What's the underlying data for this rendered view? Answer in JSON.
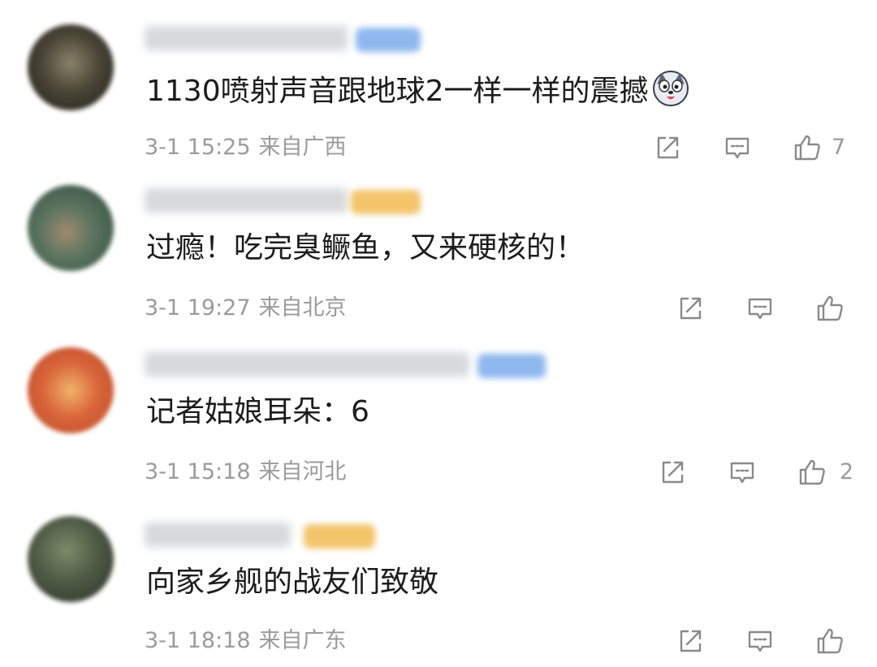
{
  "comments": [
    {
      "text": "1130喷射声音跟地球2一样一样的震撼",
      "emoji": "husky-face-emoji",
      "time": "3-1 15:25",
      "location": "来自广西",
      "like_count": "7",
      "avatar_color": "#4a4636",
      "badge_color": "#8fb8ee"
    },
    {
      "text": "过瘾！吃完臭鳜鱼，又来硬核的！",
      "time": "3-1 19:27",
      "location": "来自北京",
      "like_count": "",
      "avatar_color": "#5b7460",
      "badge_color": "#f3c46a"
    },
    {
      "text": "记者姑娘耳朵：6",
      "time": "3-1 15:18",
      "location": "来自河北",
      "like_count": "2",
      "avatar_color": "#d9653a",
      "badge_color": "#8fb8ee"
    },
    {
      "text": "向家乡舰的战友们致敬",
      "time": "3-1 18:18",
      "location": "来自广东",
      "like_count": "",
      "avatar_color": "#4f5a45",
      "badge_color": "#f3c46a"
    }
  ],
  "icons": {
    "share": "share-icon",
    "reply": "comment-icon",
    "like": "thumbs-up-icon"
  },
  "colors": {
    "meta_text": "#9b9b9b",
    "content_text": "#1c1c1c",
    "icon_stroke": "#8a8a8a"
  }
}
